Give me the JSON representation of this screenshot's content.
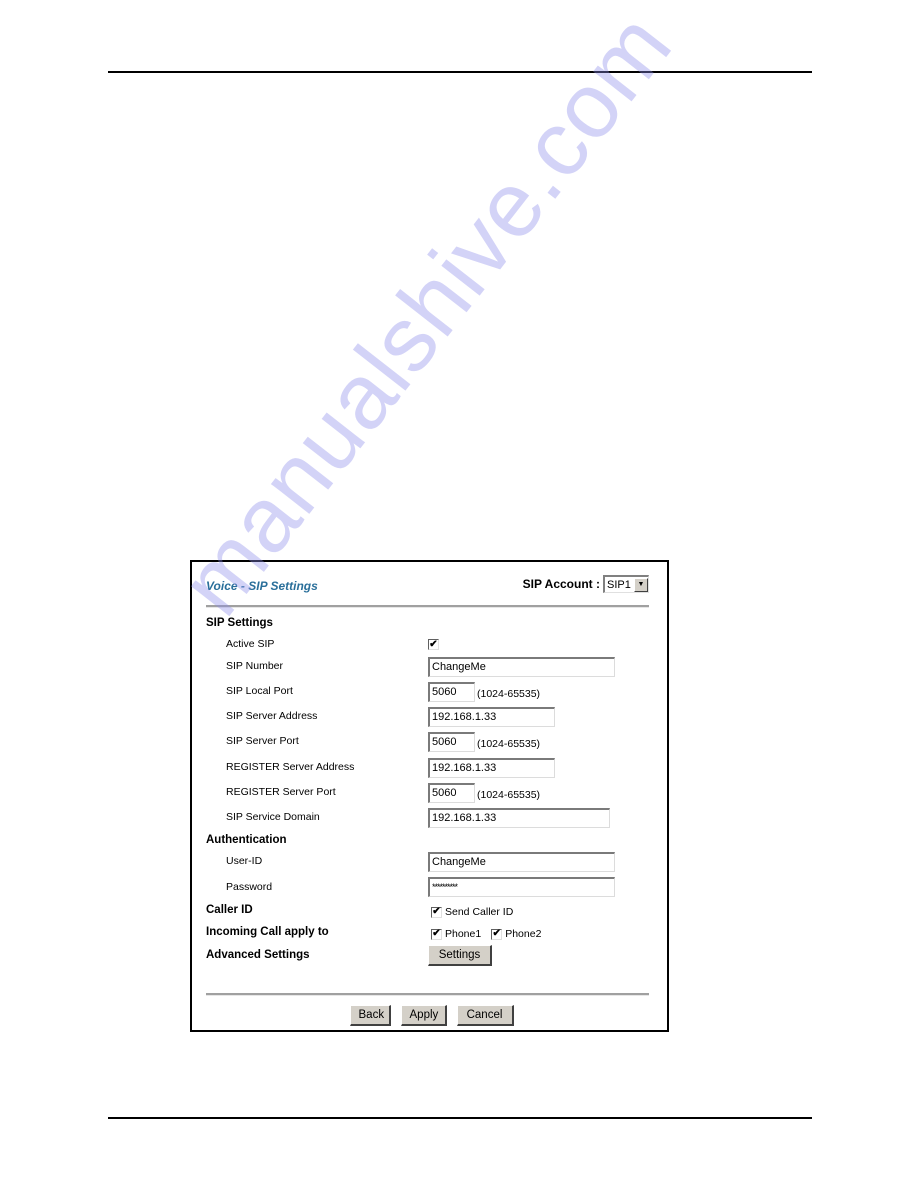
{
  "watermark": "manualshive.com",
  "panel": {
    "title": "Voice - SIP Settings",
    "account_label": "SIP Account :",
    "account_value": "SIP1"
  },
  "sip_settings": {
    "heading": "SIP Settings",
    "active_sip": {
      "label": "Active SIP",
      "checked": true
    },
    "sip_number": {
      "label": "SIP Number",
      "value": "ChangeMe"
    },
    "sip_local_port": {
      "label": "SIP Local Port",
      "value": "5060",
      "range": "(1024-65535)"
    },
    "sip_server_address": {
      "label": "SIP Server Address",
      "value": "192.168.1.33"
    },
    "sip_server_port": {
      "label": "SIP Server Port",
      "value": "5060",
      "range": "(1024-65535)"
    },
    "register_server_address": {
      "label": "REGISTER Server Address",
      "value": "192.168.1.33"
    },
    "register_server_port": {
      "label": "REGISTER Server Port",
      "value": "5060",
      "range": "(1024-65535)"
    },
    "sip_service_domain": {
      "label": "SIP Service Domain",
      "value": "192.168.1.33"
    }
  },
  "authentication": {
    "heading": "Authentication",
    "user_id": {
      "label": "User-ID",
      "value": "ChangeMe"
    },
    "password": {
      "label": "Password",
      "value": "**********"
    }
  },
  "caller_id": {
    "heading": "Caller ID",
    "option": "Send Caller ID",
    "checked": true
  },
  "incoming_call": {
    "heading": "Incoming Call apply to",
    "options": [
      {
        "label": "Phone1",
        "checked": true
      },
      {
        "label": "Phone2",
        "checked": true
      }
    ]
  },
  "advanced": {
    "heading": "Advanced Settings",
    "button": "Settings"
  },
  "footer": {
    "back": "Back",
    "apply": "Apply",
    "cancel": "Cancel"
  },
  "check_glyph": "✔",
  "arrow_glyph": "▼"
}
